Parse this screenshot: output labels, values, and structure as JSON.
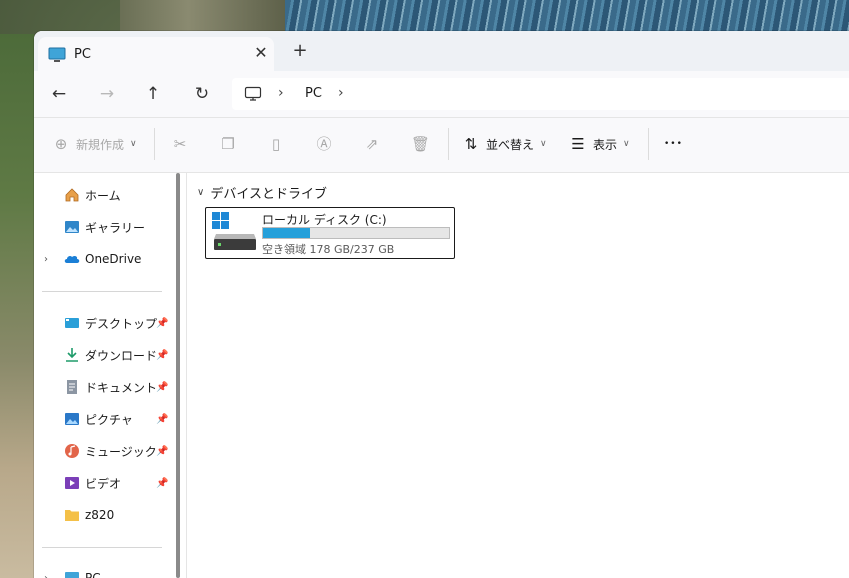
{
  "colors": {
    "accent": "#26a0da",
    "window_bg": "#ffffff",
    "chrome_bg": "#eef1f5"
  },
  "tab": {
    "title": "PC",
    "close_glyph": "✕",
    "new_tab_glyph": "+"
  },
  "nav": {
    "back": "←",
    "forward": "→",
    "up": "↑",
    "refresh": "↻"
  },
  "address": {
    "root_icon": "monitor-icon",
    "chevron": "›",
    "crumb": "PC"
  },
  "commands": {
    "new": "新規作成",
    "sort": "並べ替え",
    "view": "表示",
    "more": "•••"
  },
  "sidebar": {
    "items": [
      {
        "label": "ホーム",
        "icon": "home-icon",
        "pinned": false
      },
      {
        "label": "ギャラリー",
        "icon": "gallery-icon",
        "pinned": false
      },
      {
        "label": "OneDrive",
        "icon": "onedrive-icon",
        "pinned": false,
        "expandable": true
      },
      {
        "label": "デスクトップ",
        "icon": "desktop-icon",
        "pinned": true
      },
      {
        "label": "ダウンロード",
        "icon": "download-icon",
        "pinned": true
      },
      {
        "label": "ドキュメント",
        "icon": "document-icon",
        "pinned": true
      },
      {
        "label": "ピクチャ",
        "icon": "pictures-icon",
        "pinned": true
      },
      {
        "label": "ミュージック",
        "icon": "music-icon",
        "pinned": true
      },
      {
        "label": "ビデオ",
        "icon": "video-icon",
        "pinned": true
      },
      {
        "label": "z820",
        "icon": "folder-icon",
        "pinned": false
      },
      {
        "label": "PC",
        "icon": "pc-icon",
        "pinned": false,
        "expandable": true
      }
    ]
  },
  "content": {
    "group_title": "デバイスとドライブ",
    "drives": [
      {
        "name": "ローカル ディスク (C:)",
        "space_text": "空き領域 178 GB/237 GB",
        "used_fraction": 0.25
      }
    ]
  }
}
